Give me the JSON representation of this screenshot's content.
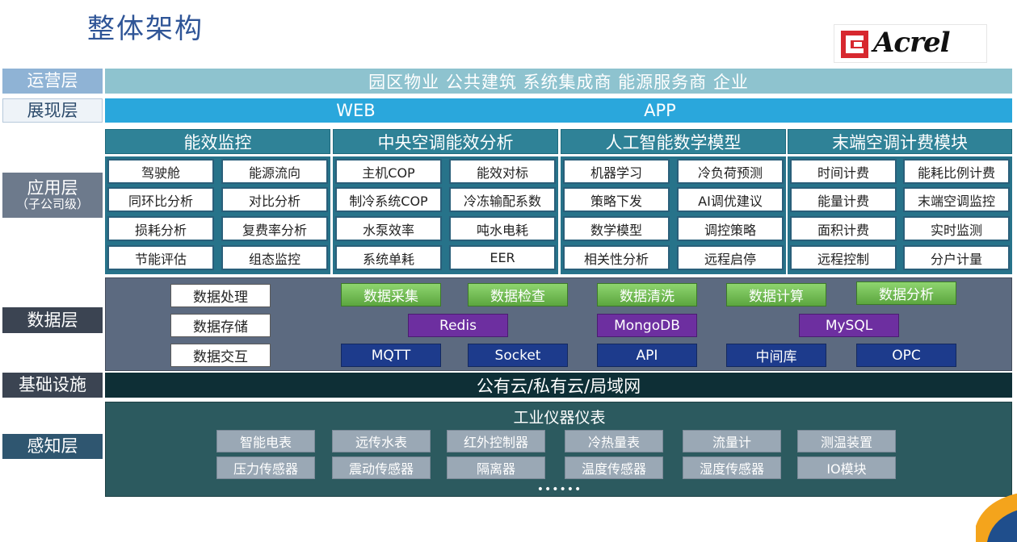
{
  "title": "整体架构",
  "logo": {
    "text": "Acrel"
  },
  "colors": {
    "brand_red": "#d7282f",
    "title_blue": "#2f5597",
    "accent_orange": "#f4a41c"
  },
  "layers": {
    "ops": {
      "label": "运营层",
      "text": "园区物业 公共建筑 系统集成商 能源服务商 企业"
    },
    "presentation": {
      "label": "展现层",
      "items": [
        "WEB",
        "APP"
      ]
    },
    "application": {
      "label": "应用层",
      "sublabel": "（子公司级）",
      "categories": [
        {
          "name": "能效监控",
          "items": [
            "驾驶舱",
            "能源流向",
            "同环比分析",
            "对比分析",
            "损耗分析",
            "复费率分析",
            "节能评估",
            "组态监控"
          ]
        },
        {
          "name": "中央空调能效分析",
          "items": [
            "主机COP",
            "能效对标",
            "制冷系统COP",
            "冷冻输配系数",
            "水泵效率",
            "吨水电耗",
            "系统单耗",
            "EER"
          ]
        },
        {
          "name": "人工智能数学模型",
          "items": [
            "机器学习",
            "冷负荷预测",
            "策略下发",
            "AI调优建议",
            "数学模型",
            "调控策略",
            "相关性分析",
            "远程启停"
          ]
        },
        {
          "name": "末端空调计费模块",
          "items": [
            "时间计费",
            "能耗比例计费",
            "能量计费",
            "末端空调监控",
            "面积计费",
            "实时监测",
            "远程控制",
            "分户计量"
          ]
        }
      ]
    },
    "data": {
      "label": "数据层",
      "white": [
        "数据处理",
        "数据存储",
        "数据交互"
      ],
      "green": [
        "数据采集",
        "数据检查",
        "数据清洗",
        "数据计算",
        "数据分析"
      ],
      "purple": [
        "Redis",
        "MongoDB",
        "MySQL"
      ],
      "navy": [
        "MQTT",
        "Socket",
        "API",
        "中间库",
        "OPC"
      ]
    },
    "infra": {
      "label": "基础设施",
      "text": "公有云/私有云/局域网"
    },
    "sensing": {
      "label": "感知层",
      "title": "工业仪器仪表",
      "items": [
        "智能电表",
        "远传水表",
        "红外控制器",
        "冷热量表",
        "流量计",
        "测温装置",
        "压力传感器",
        "震动传感器",
        "隔离器",
        "温度传感器",
        "湿度传感器",
        "IO模块"
      ],
      "more": "••••••"
    }
  }
}
